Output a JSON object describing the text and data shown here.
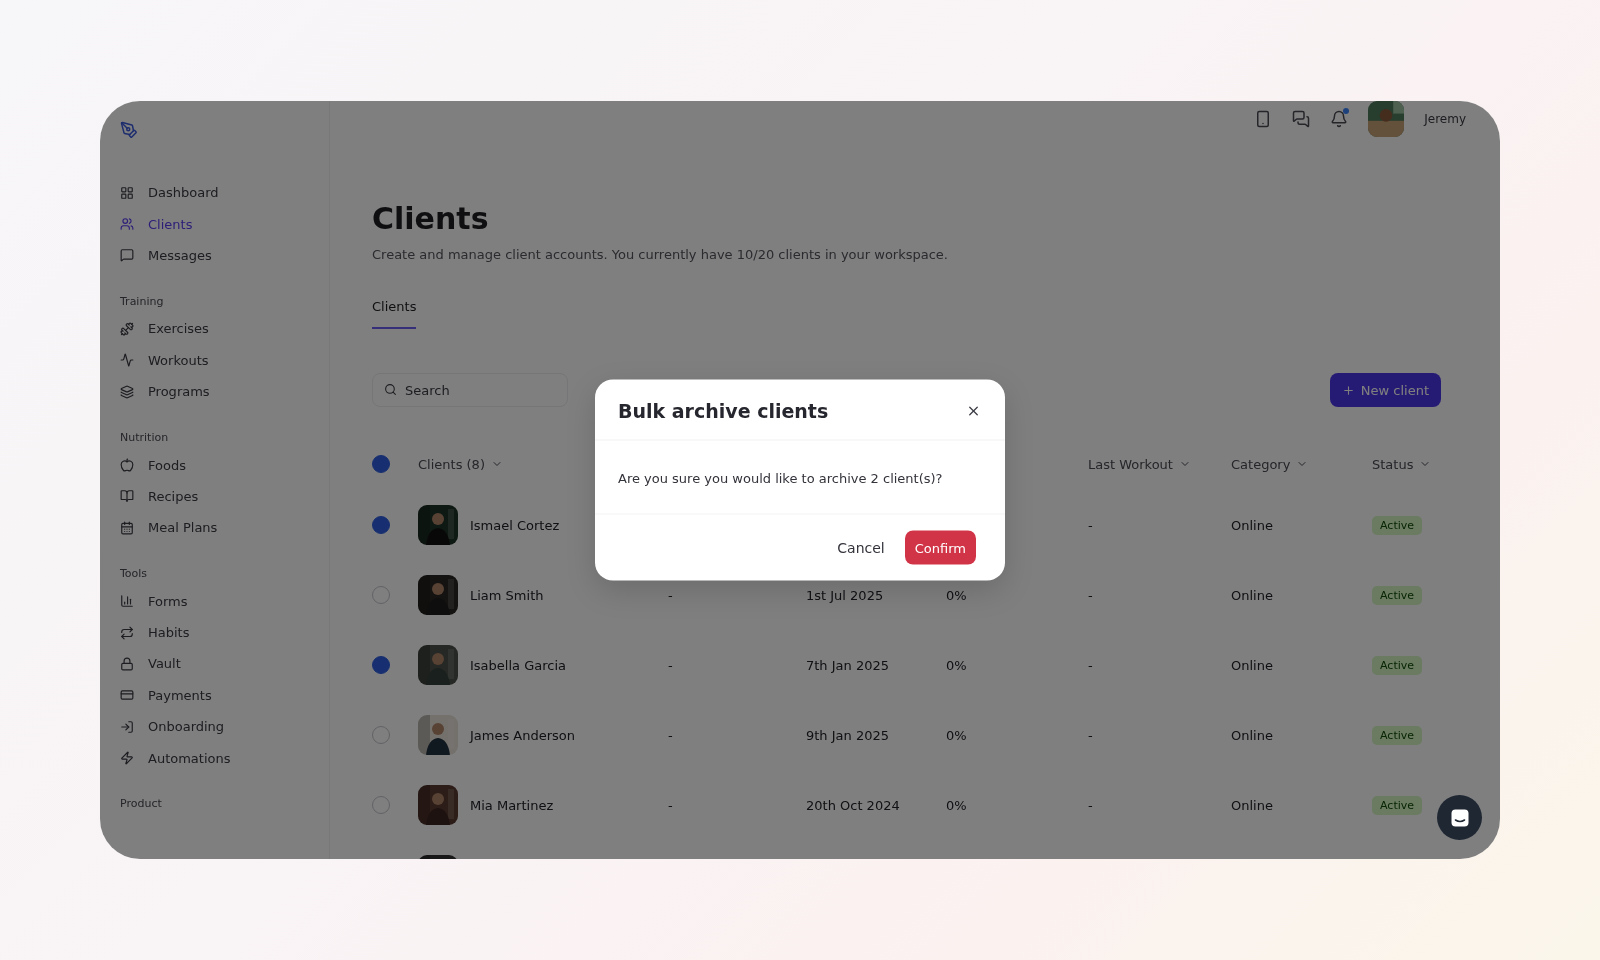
{
  "sidebar": {
    "sections": [
      {
        "items": [
          {
            "label": "Dashboard",
            "selected": false
          },
          {
            "label": "Clients",
            "selected": true
          },
          {
            "label": "Messages",
            "selected": false
          }
        ]
      },
      {
        "heading": "Training",
        "items": [
          {
            "label": "Exercises",
            "selected": false
          },
          {
            "label": "Workouts",
            "selected": false
          },
          {
            "label": "Programs",
            "selected": false
          }
        ]
      },
      {
        "heading": "Nutrition",
        "items": [
          {
            "label": "Foods",
            "selected": false
          },
          {
            "label": "Recipes",
            "selected": false
          },
          {
            "label": "Meal Plans",
            "selected": false
          }
        ]
      },
      {
        "heading": "Tools",
        "items": [
          {
            "label": "Forms",
            "selected": false
          },
          {
            "label": "Habits",
            "selected": false
          },
          {
            "label": "Vault",
            "selected": false
          },
          {
            "label": "Payments",
            "selected": false
          },
          {
            "label": "Onboarding",
            "selected": false
          },
          {
            "label": "Automations",
            "selected": false
          }
        ]
      },
      {
        "heading": "Product"
      }
    ]
  },
  "topbar": {
    "has_notification": true,
    "user_name": "Jeremy"
  },
  "page": {
    "title": "Clients",
    "subtitle": "Create and manage client accounts. You currently have 10/20 clients in your workspace.",
    "tabs": [
      {
        "label": "Clients",
        "selected": true
      }
    ],
    "search": {
      "placeholder": "Search"
    },
    "new_button": "New client"
  },
  "table": {
    "header": {
      "checked": true,
      "client": "Clients (8)",
      "last_workout": "Last Workout",
      "category": "Category",
      "status": "Status"
    },
    "rows": [
      {
        "checked": true,
        "name": "Ismael Cortez",
        "last_workout": "-",
        "category": "Online",
        "status": "Active"
      },
      {
        "checked": false,
        "name": "Liam Smith",
        "column_2": "-",
        "column_3": "1st Jul 2025",
        "column_4": "0%",
        "last_workout": "-",
        "category": "Online",
        "status": "Active"
      },
      {
        "checked": true,
        "name": "Isabella Garcia",
        "column_2": "-",
        "column_3": "7th Jan 2025",
        "column_4": "0%",
        "last_workout": "-",
        "category": "Online",
        "status": "Active"
      },
      {
        "checked": false,
        "name": "James Anderson",
        "column_2": "-",
        "column_3": "9th Jan 2025",
        "column_4": "0%",
        "last_workout": "-",
        "category": "Online",
        "status": "Active"
      },
      {
        "checked": false,
        "name": "Mia Martinez",
        "column_2": "-",
        "column_3": "20th Oct 2024",
        "column_4": "0%",
        "last_workout": "-",
        "category": "Online",
        "status": "Active"
      },
      {}
    ]
  },
  "modal": {
    "title": "Bulk archive clients",
    "message": "Are you sure you would like to archive 2 client(s)?",
    "cancel": "Cancel",
    "confirm": "Confirm"
  }
}
